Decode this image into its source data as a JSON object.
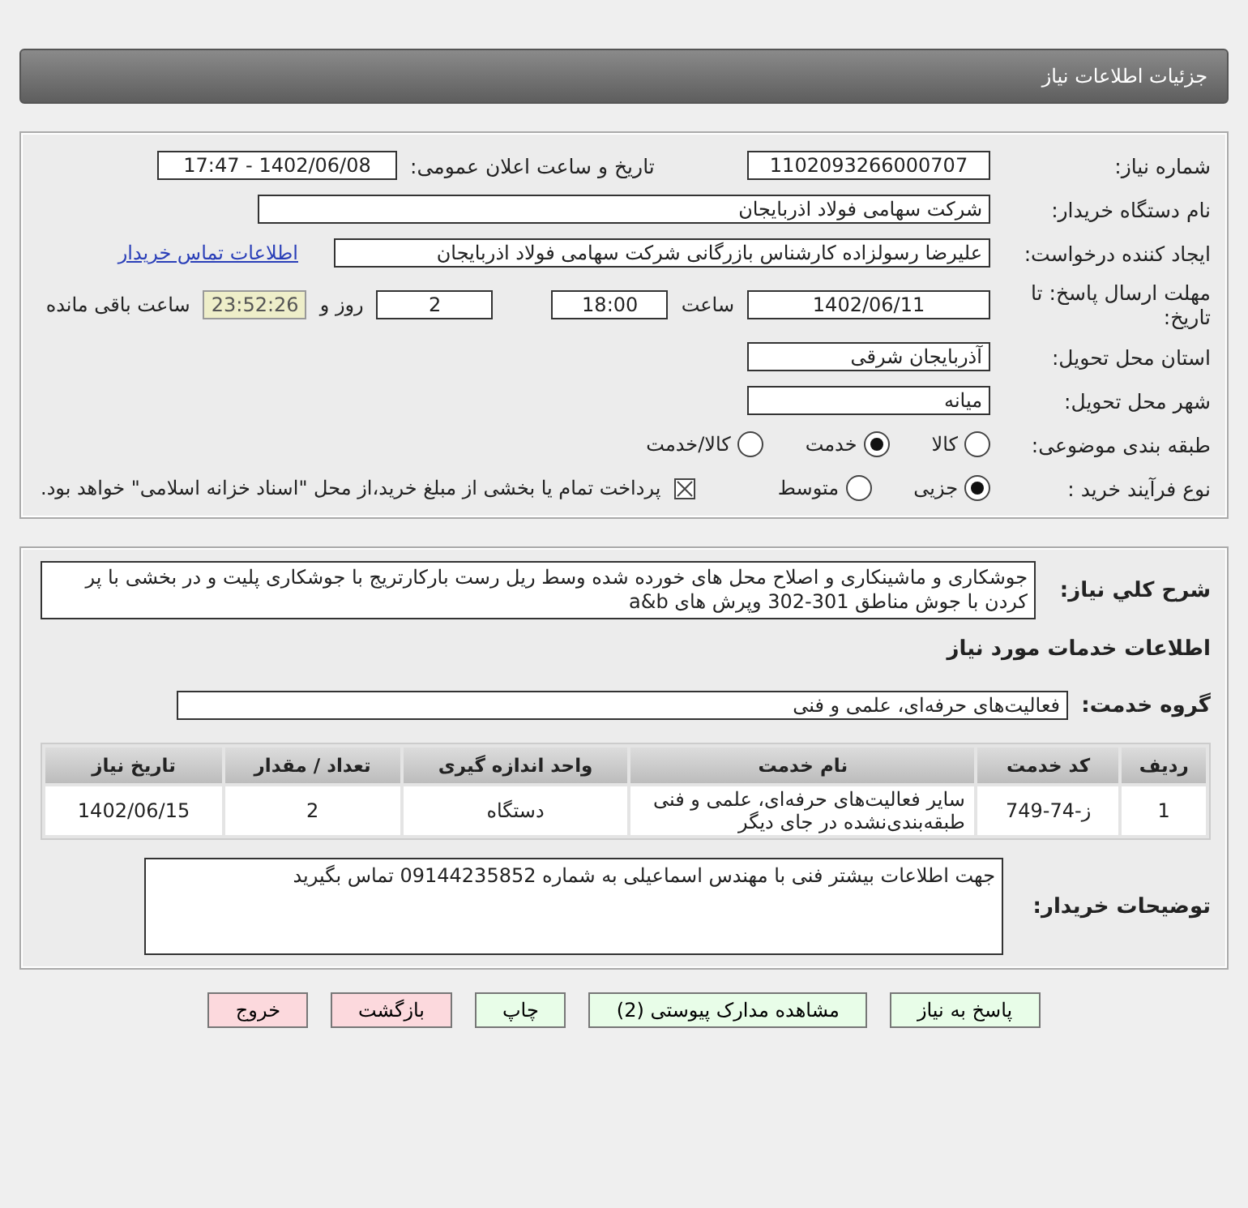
{
  "header": {
    "title": "جزئیات اطلاعات نیاز"
  },
  "details": {
    "need_number": {
      "label": "شماره نیاز:",
      "value": "1102093266000707"
    },
    "announce": {
      "label": "تاریخ و ساعت اعلان عمومی:",
      "value": "1402/06/08 - 17:47"
    },
    "buyer_org": {
      "label": "نام دستگاه خریدار:",
      "value": "شرکت سهامی فولاد اذربایجان"
    },
    "requester": {
      "label": "ایجاد کننده درخواست:",
      "value": "علیرضا رسولزاده کارشناس بازرگانی شرکت سهامی فولاد اذربایجان",
      "link": "اطلاعات تماس خریدار"
    },
    "deadline": {
      "label": "مهلت ارسال پاسخ: تا تاریخ:",
      "date": "1402/06/11",
      "time_label": "ساعت",
      "time": "18:00",
      "days": "2",
      "days_label": "روز و",
      "remaining": "23:52:26",
      "remaining_label": "ساعت باقی مانده"
    },
    "province": {
      "label": "استان محل تحویل:",
      "value": "آذربایجان شرقی"
    },
    "city": {
      "label": "شهر محل تحویل:",
      "value": "میانه"
    },
    "category": {
      "label": "طبقه بندی موضوعی:",
      "options": [
        {
          "label": "کالا",
          "selected": false
        },
        {
          "label": "خدمت",
          "selected": true
        },
        {
          "label": "کالا/خدمت",
          "selected": false
        }
      ]
    },
    "process": {
      "label": "نوع فرآیند خرید :",
      "options": [
        {
          "label": "جزیی",
          "selected": true
        },
        {
          "label": "متوسط",
          "selected": false
        }
      ],
      "payment_note": {
        "text": "پرداخت تمام یا بخشی از مبلغ خرید،از محل \"اسناد خزانه اسلامی\" خواهد بود.",
        "checked": true
      }
    }
  },
  "summary": {
    "label": "شرح کلي نياز:",
    "text": "جوشکاری و ماشینکاری و اصلاح محل های خورده شده وسط ریل رست بارکارتریج با جوشکاری پلیت و در بخشی با پر کردن با جوش  مناطق 301-302   وپرش های a&b"
  },
  "services_title": "اطلاعات خدمات مورد نیاز",
  "service_group": {
    "label": "گروه خدمت:",
    "value": "فعالیت‌های حرفه‌ای، علمی و فنی"
  },
  "table": {
    "columns": [
      "ردیف",
      "کد خدمت",
      "نام خدمت",
      "واحد اندازه گیری",
      "تعداد / مقدار",
      "تاریخ نیاز"
    ],
    "rows": [
      [
        "1",
        "ز-74-749",
        "سایر فعالیت‌های حرفه‌ای، علمی و فنی طبقه‌بندی‌نشده در جای دیگر",
        "دستگاه",
        "2",
        "1402/06/15"
      ]
    ]
  },
  "buyer_notes": {
    "label": "توضیحات خریدار:",
    "text": "جهت اطلاعات بیشتر فنی با مهندس اسماعیلی به شماره 09144235852 تماس بگیرید"
  },
  "buttons": [
    {
      "label": "پاسخ به نیاز",
      "kind": "ok"
    },
    {
      "label": "مشاهده مدارک پیوستی (2)",
      "kind": "ok"
    },
    {
      "label": "چاپ",
      "kind": "ok"
    },
    {
      "label": "بازگشت",
      "kind": "danger"
    },
    {
      "label": "خروج",
      "kind": "danger"
    }
  ]
}
